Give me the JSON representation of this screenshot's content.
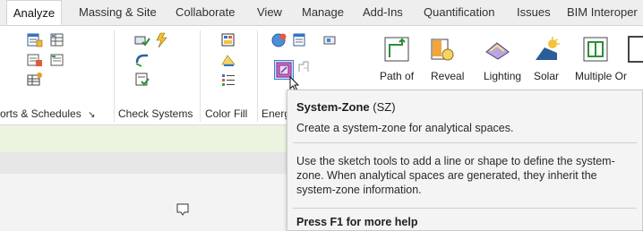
{
  "tabs": [
    "Analyze",
    "Massing & Site",
    "Collaborate",
    "View",
    "Manage",
    "Add-Ins",
    "Quantification",
    "Issues",
    "BIM Interoper"
  ],
  "active_tab": "Analyze",
  "panels": {
    "reports": "orts & Schedules",
    "reports_arrow": "↘",
    "check_systems": "Check Systems",
    "color_fill": "Color Fill",
    "energy": "Energ"
  },
  "big_buttons": [
    {
      "label": "Path of"
    },
    {
      "label": "Reveal"
    },
    {
      "label": "Lighting"
    },
    {
      "label": "Solar"
    },
    {
      "label": "Multiple Or"
    }
  ],
  "tooltip": {
    "title": "System-Zone",
    "shortcut": "(SZ)",
    "description": "Create a system-zone for analytical spaces.",
    "details": "Use the sketch tools to add a line or shape to define the system-zone. When analytical spaces are generated, they inherit the system-zone information.",
    "footer": "Press F1 for more help"
  },
  "icons": {
    "reports": [
      "report-table-icon",
      "schedule-icon",
      "duct-report-icon",
      "pipe-report-icon",
      "schedule-grid-icon"
    ],
    "check_systems": [
      "check-duct-icon",
      "check-electrical-icon",
      "check-pipe-icon",
      "show-disconnects-icon"
    ],
    "color_fill": [
      "legend-icon",
      "color-scheme-icon",
      "color-list-icon"
    ],
    "energy": [
      "energy-settings-icon",
      "create-energy-model-icon",
      "system-zone-icon",
      "space-icon",
      "room-icon"
    ],
    "cursor": "mouse-cursor-icon",
    "comment": "comment-icon"
  },
  "colors": {
    "accent": "#3c7fd6",
    "green_strip": "#eaf4df"
  }
}
